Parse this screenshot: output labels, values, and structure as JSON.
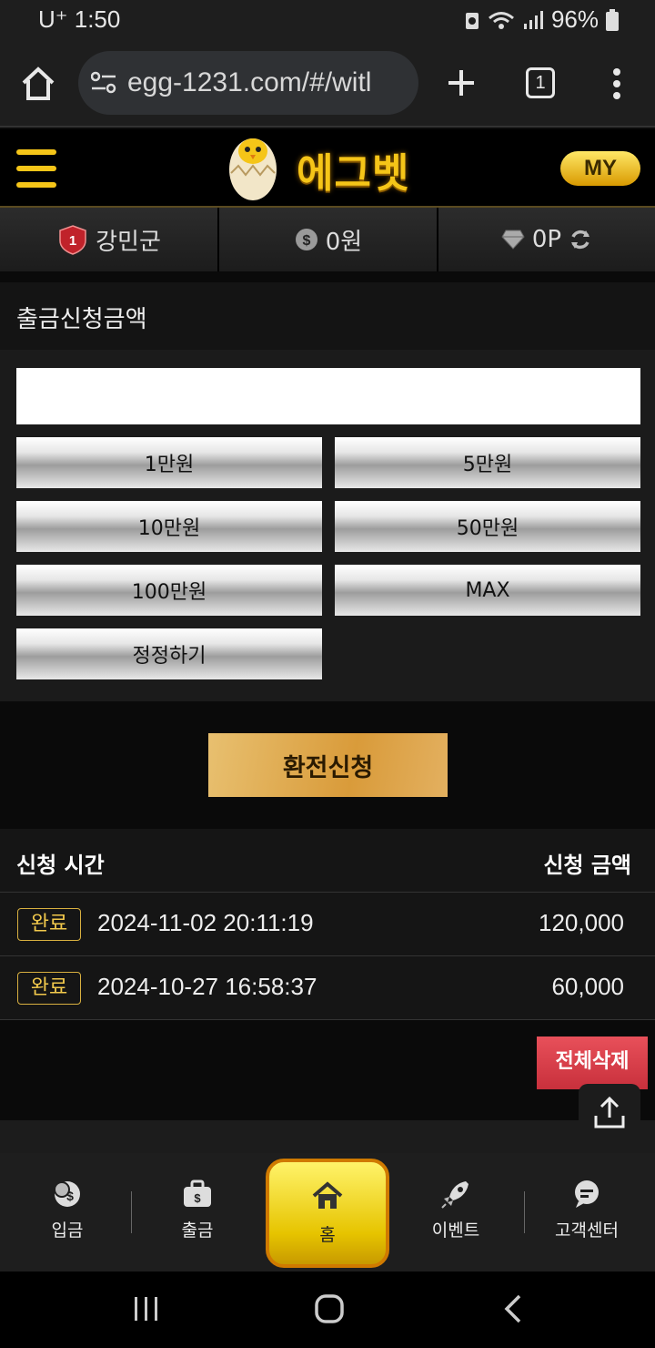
{
  "status_bar": {
    "carrier": "U⁺",
    "time": "1:50",
    "battery": "96%"
  },
  "browser": {
    "url": "egg-1231.com/#/witl",
    "tab_count": "1"
  },
  "site": {
    "logo_text": "에그벳",
    "my_label": "MY"
  },
  "user": {
    "level": "1",
    "name": "강민군",
    "money": "0원",
    "points": "0P"
  },
  "withdraw": {
    "section_title": "출금신청금액",
    "input_value": "",
    "amount_buttons": [
      "1만원",
      "5만원",
      "10만원",
      "50만원",
      "100만원",
      "MAX"
    ],
    "reset_label": "정정하기",
    "submit_label": "환전신청"
  },
  "history": {
    "col_time": "신청 시간",
    "col_amount": "신청 금액",
    "rows": [
      {
        "status": "완료",
        "time": "2024-11-02 20:11:19",
        "amount": "120,000"
      },
      {
        "status": "완료",
        "time": "2024-10-27 16:58:37",
        "amount": "60,000"
      }
    ],
    "delete_all_label": "전체삭제"
  },
  "bottom_nav": {
    "deposit": "입금",
    "withdraw": "출금",
    "home": "홈",
    "event": "이벤트",
    "support": "고객센터"
  },
  "colors": {
    "accent_gold": "#f5c518",
    "home_yellow": "#e6c400",
    "delete_red": "#d8404c"
  }
}
